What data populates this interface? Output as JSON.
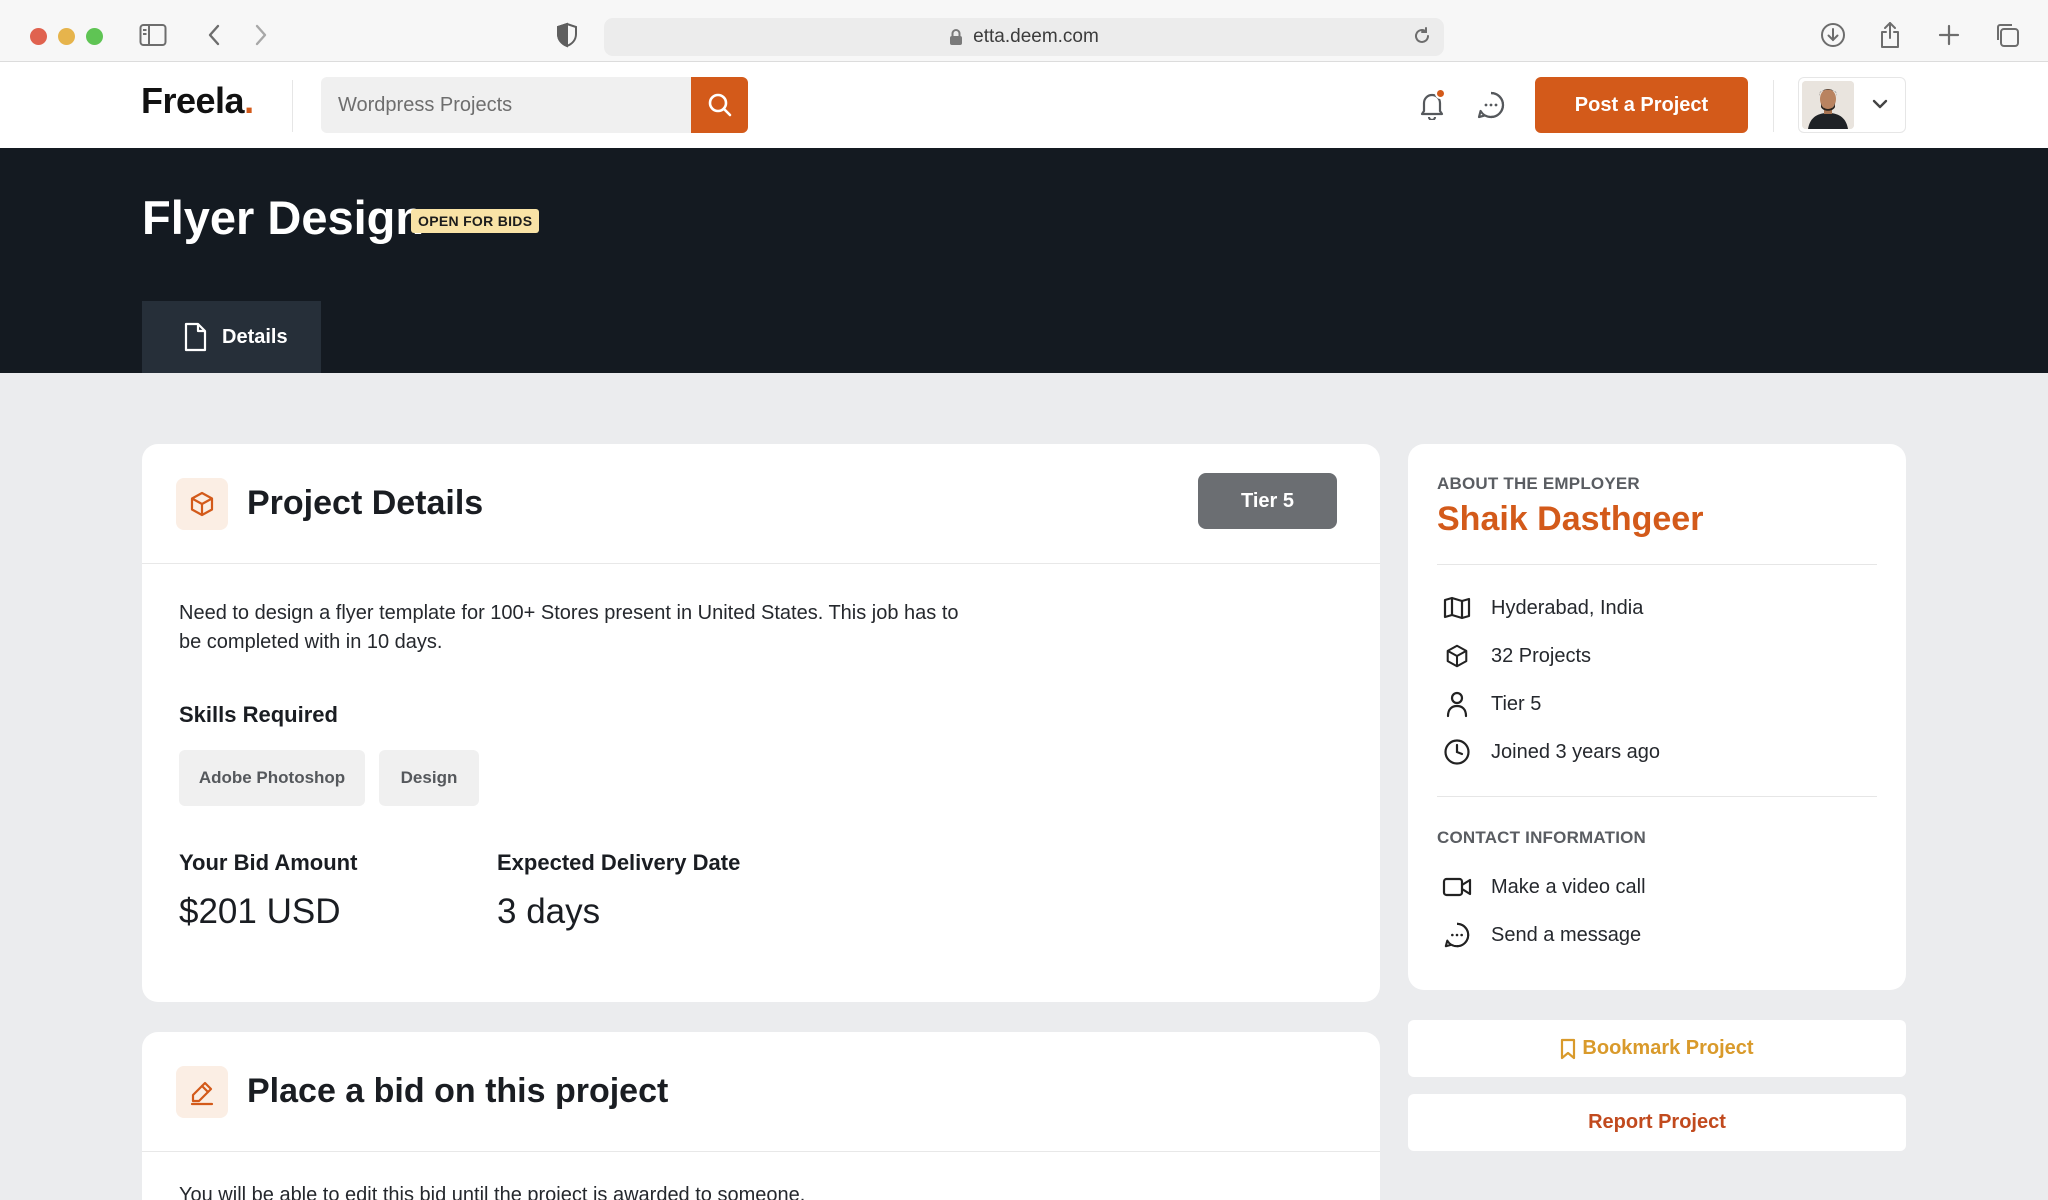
{
  "browser": {
    "url": "etta.deem.com"
  },
  "header": {
    "logo": "Freela",
    "logo_dot": ".",
    "search_placeholder": "Wordpress Projects",
    "post_button": "Post a Project"
  },
  "hero": {
    "title": "Flyer Design",
    "status_badge": "OPEN FOR BIDS",
    "tab_details": "Details"
  },
  "project": {
    "title": "Project Details",
    "tier": "Tier 5",
    "description": "Need to design a flyer template for 100+ Stores present in United States. This job has to be completed with in 10 days.",
    "skills_label": "Skills Required",
    "skills": [
      "Adobe Photoshop",
      "Design"
    ],
    "bid_label": "Your Bid Amount",
    "bid_value": "$201 USD",
    "delivery_label": "Expected Delivery Date",
    "delivery_value": "3 days"
  },
  "bid_section": {
    "title": "Place a bid on this project",
    "note": "You will be able to edit this bid until the project is awarded to someone."
  },
  "employer": {
    "section_label": "ABOUT THE EMPLOYER",
    "name": "Shaik Dasthgeer",
    "location": "Hyderabad, India",
    "projects": "32 Projects",
    "tier": "Tier 5",
    "joined": "Joined 3 years ago",
    "contact_label": "CONTACT INFORMATION",
    "video_call": "Make a video call",
    "message": "Send a message"
  },
  "actions": {
    "bookmark": "Bookmark Project",
    "report": "Report Project"
  },
  "colors": {
    "accent": "#d35a1a",
    "hero_bg": "#141a21",
    "badge_bg": "#f9e3a6",
    "bookmark": "#d99a2b",
    "page_bg": "#ebecee"
  },
  "icons": {
    "sidebar": "sidebar-icon",
    "back": "chevron-left-icon",
    "forward": "chevron-right-icon",
    "shield": "shield-icon",
    "lock": "lock-icon",
    "reload": "reload-icon",
    "download": "download-icon",
    "share": "share-icon",
    "new_tab": "plus-icon",
    "tabs": "tabs-icon",
    "search": "search-icon",
    "notifications": "bell-icon",
    "messages": "chat-icon",
    "dropdown": "chevron-down-icon",
    "details": "document-icon",
    "project": "cube-icon",
    "bid": "pencil-icon",
    "location": "map-icon",
    "projects": "cube-icon",
    "tier": "user-icon",
    "joined": "clock-icon",
    "video": "video-icon",
    "message": "chat-icon",
    "bookmark": "bookmark-icon"
  }
}
